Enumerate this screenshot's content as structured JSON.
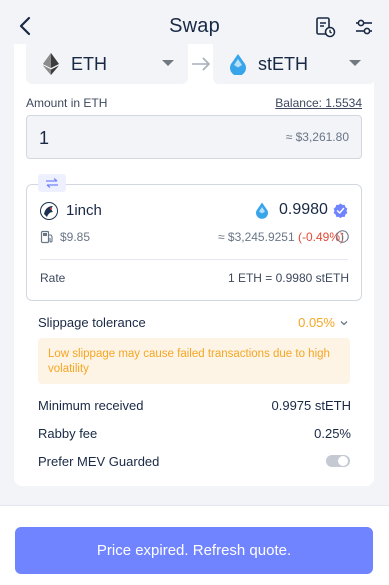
{
  "header": {
    "title": "Swap",
    "back_icon": "chevron-left-icon",
    "history_icon": "history-icon",
    "settings_icon": "settings-sliders-icon"
  },
  "pair": {
    "from_token": "ETH",
    "to_token": "stETH",
    "arrow_icon": "arrow-right-icon"
  },
  "amount": {
    "label": "Amount in ETH",
    "balance": "Balance: 1.5534",
    "value": "1",
    "usd": "≈ $3,261.80"
  },
  "quote": {
    "dex_name": "1inch",
    "receive_amount": "0.9980",
    "gas_fee": "$9.85",
    "route_usd": "≈ $3,245.9251",
    "price_impact": "(-0.49%)",
    "rate_label": "Rate",
    "rate_value": "1 ETH = 0.9980 stETH"
  },
  "slippage": {
    "label": "Slippage tolerance",
    "value": "0.05%",
    "warning": "Low slippage may cause failed transactions due to high volatility"
  },
  "details": {
    "min_received_label": "Minimum received",
    "min_received_value": "0.9975 stETH",
    "fee_label": "Rabby fee",
    "fee_value": "0.25%",
    "mev_label": "Prefer MEV Guarded",
    "mev_enabled": false
  },
  "cta": {
    "label": "Price expired. Refresh quote."
  },
  "colors": {
    "accent": "#7084ff",
    "warning": "#f5a623",
    "negative": "#e34935",
    "background": "#f2f4f7"
  }
}
